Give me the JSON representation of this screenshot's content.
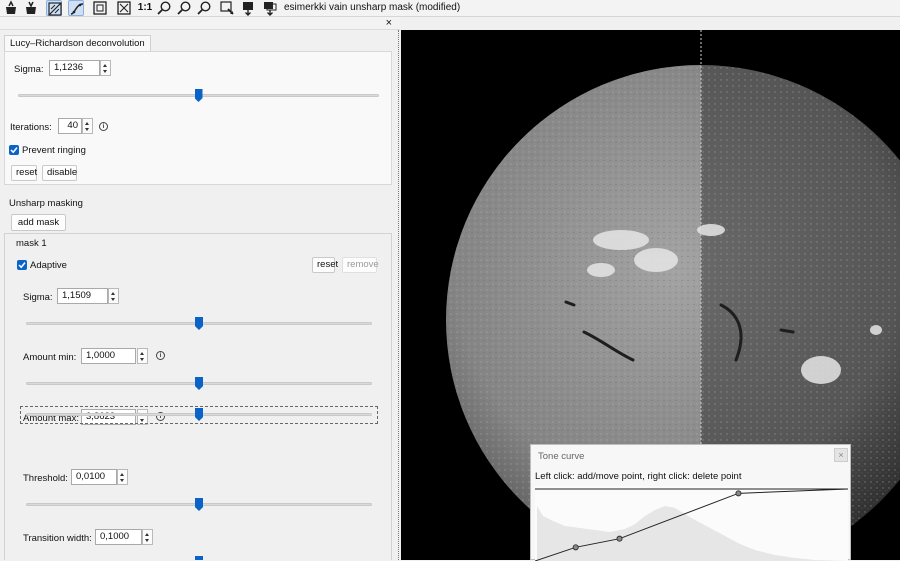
{
  "window": {
    "title": "esimerkki vain unsharp mask (modified)"
  },
  "toolbar": {
    "icons": [
      "open-file-icon",
      "save-file-icon",
      "split-view-icon",
      "tone-curve-icon",
      "fit-window-icon",
      "fit-image-icon",
      "actual-size-icon",
      "zoom-in-icon",
      "zoom-out-icon",
      "zoom-custom-icon",
      "zoom-apply-icon",
      "export-icon",
      "export-all-icon"
    ],
    "actual_size_label": "1:1"
  },
  "panel": {
    "close_glyph": "×"
  },
  "lucy": {
    "tab_label": "Lucy–Richardson deconvolution",
    "sigma_label": "Sigma:",
    "sigma_value": "1,1236",
    "sigma_slider": 0.5,
    "iterations_label": "Iterations:",
    "iterations_value": "40",
    "prevent_ringing_label": "Prevent ringing",
    "prevent_ringing_checked": true,
    "reset_label": "reset",
    "disable_label": "disable"
  },
  "unsharp": {
    "section_label": "Unsharp masking",
    "add_mask_label": "add mask",
    "mask": {
      "title": "mask 1",
      "adaptive_label": "Adaptive",
      "adaptive_checked": true,
      "reset_label": "reset",
      "remove_label": "remove",
      "sigma_label": "Sigma:",
      "sigma_value": "1,1509",
      "sigma_slider": 0.5,
      "amount_min_label": "Amount min:",
      "amount_min_value": "1,0000",
      "amount_min_slider": 0.5,
      "amount_max_label": "Amount max:",
      "amount_max_value": "3,8623",
      "amount_max_slider": 0.5,
      "threshold_label": "Threshold:",
      "threshold_value": "0,0100",
      "threshold_slider": 0.5,
      "transition_label": "Transition width:",
      "transition_value": "0,1000"
    }
  },
  "tone_curve": {
    "title": "Tone curve",
    "help_text": "Left click: add/move point, right click: delete point",
    "close_glyph": "×",
    "points": [
      [
        0.13,
        0.19
      ],
      [
        0.27,
        0.31
      ],
      [
        0.65,
        0.94
      ]
    ]
  },
  "colors": {
    "accent": "#0a64c8"
  }
}
